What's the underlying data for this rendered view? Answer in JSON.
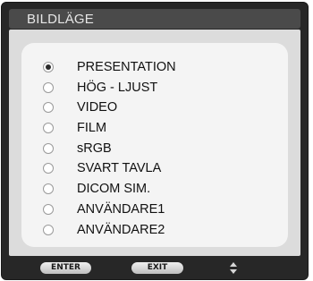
{
  "title": "BILDLÄGE",
  "options": [
    {
      "label": "PRESENTATION",
      "selected": true
    },
    {
      "label": "HÖG - LJUST",
      "selected": false
    },
    {
      "label": "VIDEO",
      "selected": false
    },
    {
      "label": "FILM",
      "selected": false
    },
    {
      "label": "sRGB",
      "selected": false
    },
    {
      "label": "SVART TAVLA",
      "selected": false
    },
    {
      "label": "DICOM SIM.",
      "selected": false
    },
    {
      "label": "ANVÄNDARE1",
      "selected": false
    },
    {
      "label": "ANVÄNDARE2",
      "selected": false
    }
  ],
  "footer": {
    "enter_label": "ENTER",
    "exit_label": "EXIT",
    "navigate_icon": "up-down-arrows-icon"
  },
  "colors": {
    "frame": "#272727",
    "title_bar": "#4a4a4a",
    "panel": "#dcdcdc",
    "list_background": "#f4f4f4"
  }
}
